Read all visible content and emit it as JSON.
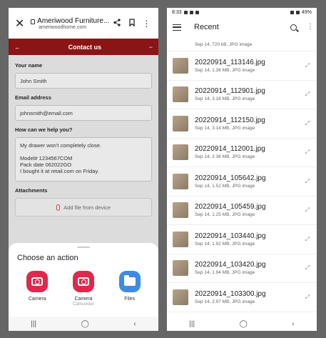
{
  "left": {
    "browser": {
      "close_glyph": "✕",
      "site_title": "Ameriwood Furniture...",
      "site_url": "ameriwoodhome.com",
      "share_glyph": "⟨",
      "bookmark_glyph": "⎕",
      "menu_glyph": "⋮"
    },
    "header": {
      "back_glyph": "←",
      "title": "Contact us",
      "collapse_glyph": "−"
    },
    "form": {
      "name_label": "Your name",
      "name_value": "John Smith",
      "email_label": "Email address",
      "email_value": "johnsmith@email.com",
      "message_label": "How can we help you?",
      "message_value": "My drawer won't completely close.\n\nModel# 1234567COM\nPack date 062022GO\nI bought it at retail.com on Friday.",
      "attachments_label": "Attachments",
      "attach_button": "Add file from device"
    },
    "sheet": {
      "title": "Choose an action",
      "actions": [
        {
          "label": "Camera",
          "sub": "",
          "icon": "camera-icon"
        },
        {
          "label": "Camera",
          "sub": "Camcorder",
          "icon": "camcorder-icon"
        },
        {
          "label": "Files",
          "sub": "",
          "icon": "folder-icon"
        }
      ]
    },
    "nav": {
      "recents": "|||",
      "home": "◯",
      "back": "‹"
    }
  },
  "right": {
    "status": {
      "time": "8:33",
      "battery": "49%"
    },
    "appbar": {
      "title": "Recent"
    },
    "first_meta": "Sep 14, 720 kB, JPG image",
    "files": [
      {
        "name": "20220914_113146.jpg",
        "meta": "Sep 14, 1.36 MB, JPG image"
      },
      {
        "name": "20220914_112901.jpg",
        "meta": "Sep 14, 3.16 MB, JPG image"
      },
      {
        "name": "20220914_112150.jpg",
        "meta": "Sep 14, 3.14 MB, JPG image"
      },
      {
        "name": "20220914_112001.jpg",
        "meta": "Sep 14, 2.36 MB, JPG image"
      },
      {
        "name": "20220914_105642.jpg",
        "meta": "Sep 14, 1.51 MB, JPG image"
      },
      {
        "name": "20220914_105459.jpg",
        "meta": "Sep 14, 1.25 MB, JPG image"
      },
      {
        "name": "20220914_103440.jpg",
        "meta": "Sep 14, 1.92 MB, JPG image"
      },
      {
        "name": "20220914_103420.jpg",
        "meta": "Sep 14, 1.94 MB, JPG image"
      },
      {
        "name": "20220914_103300.jpg",
        "meta": "Sep 14, 2.97 MB, JPG image"
      }
    ],
    "nav": {
      "recents": "|||",
      "home": "◯",
      "back": "‹"
    }
  }
}
